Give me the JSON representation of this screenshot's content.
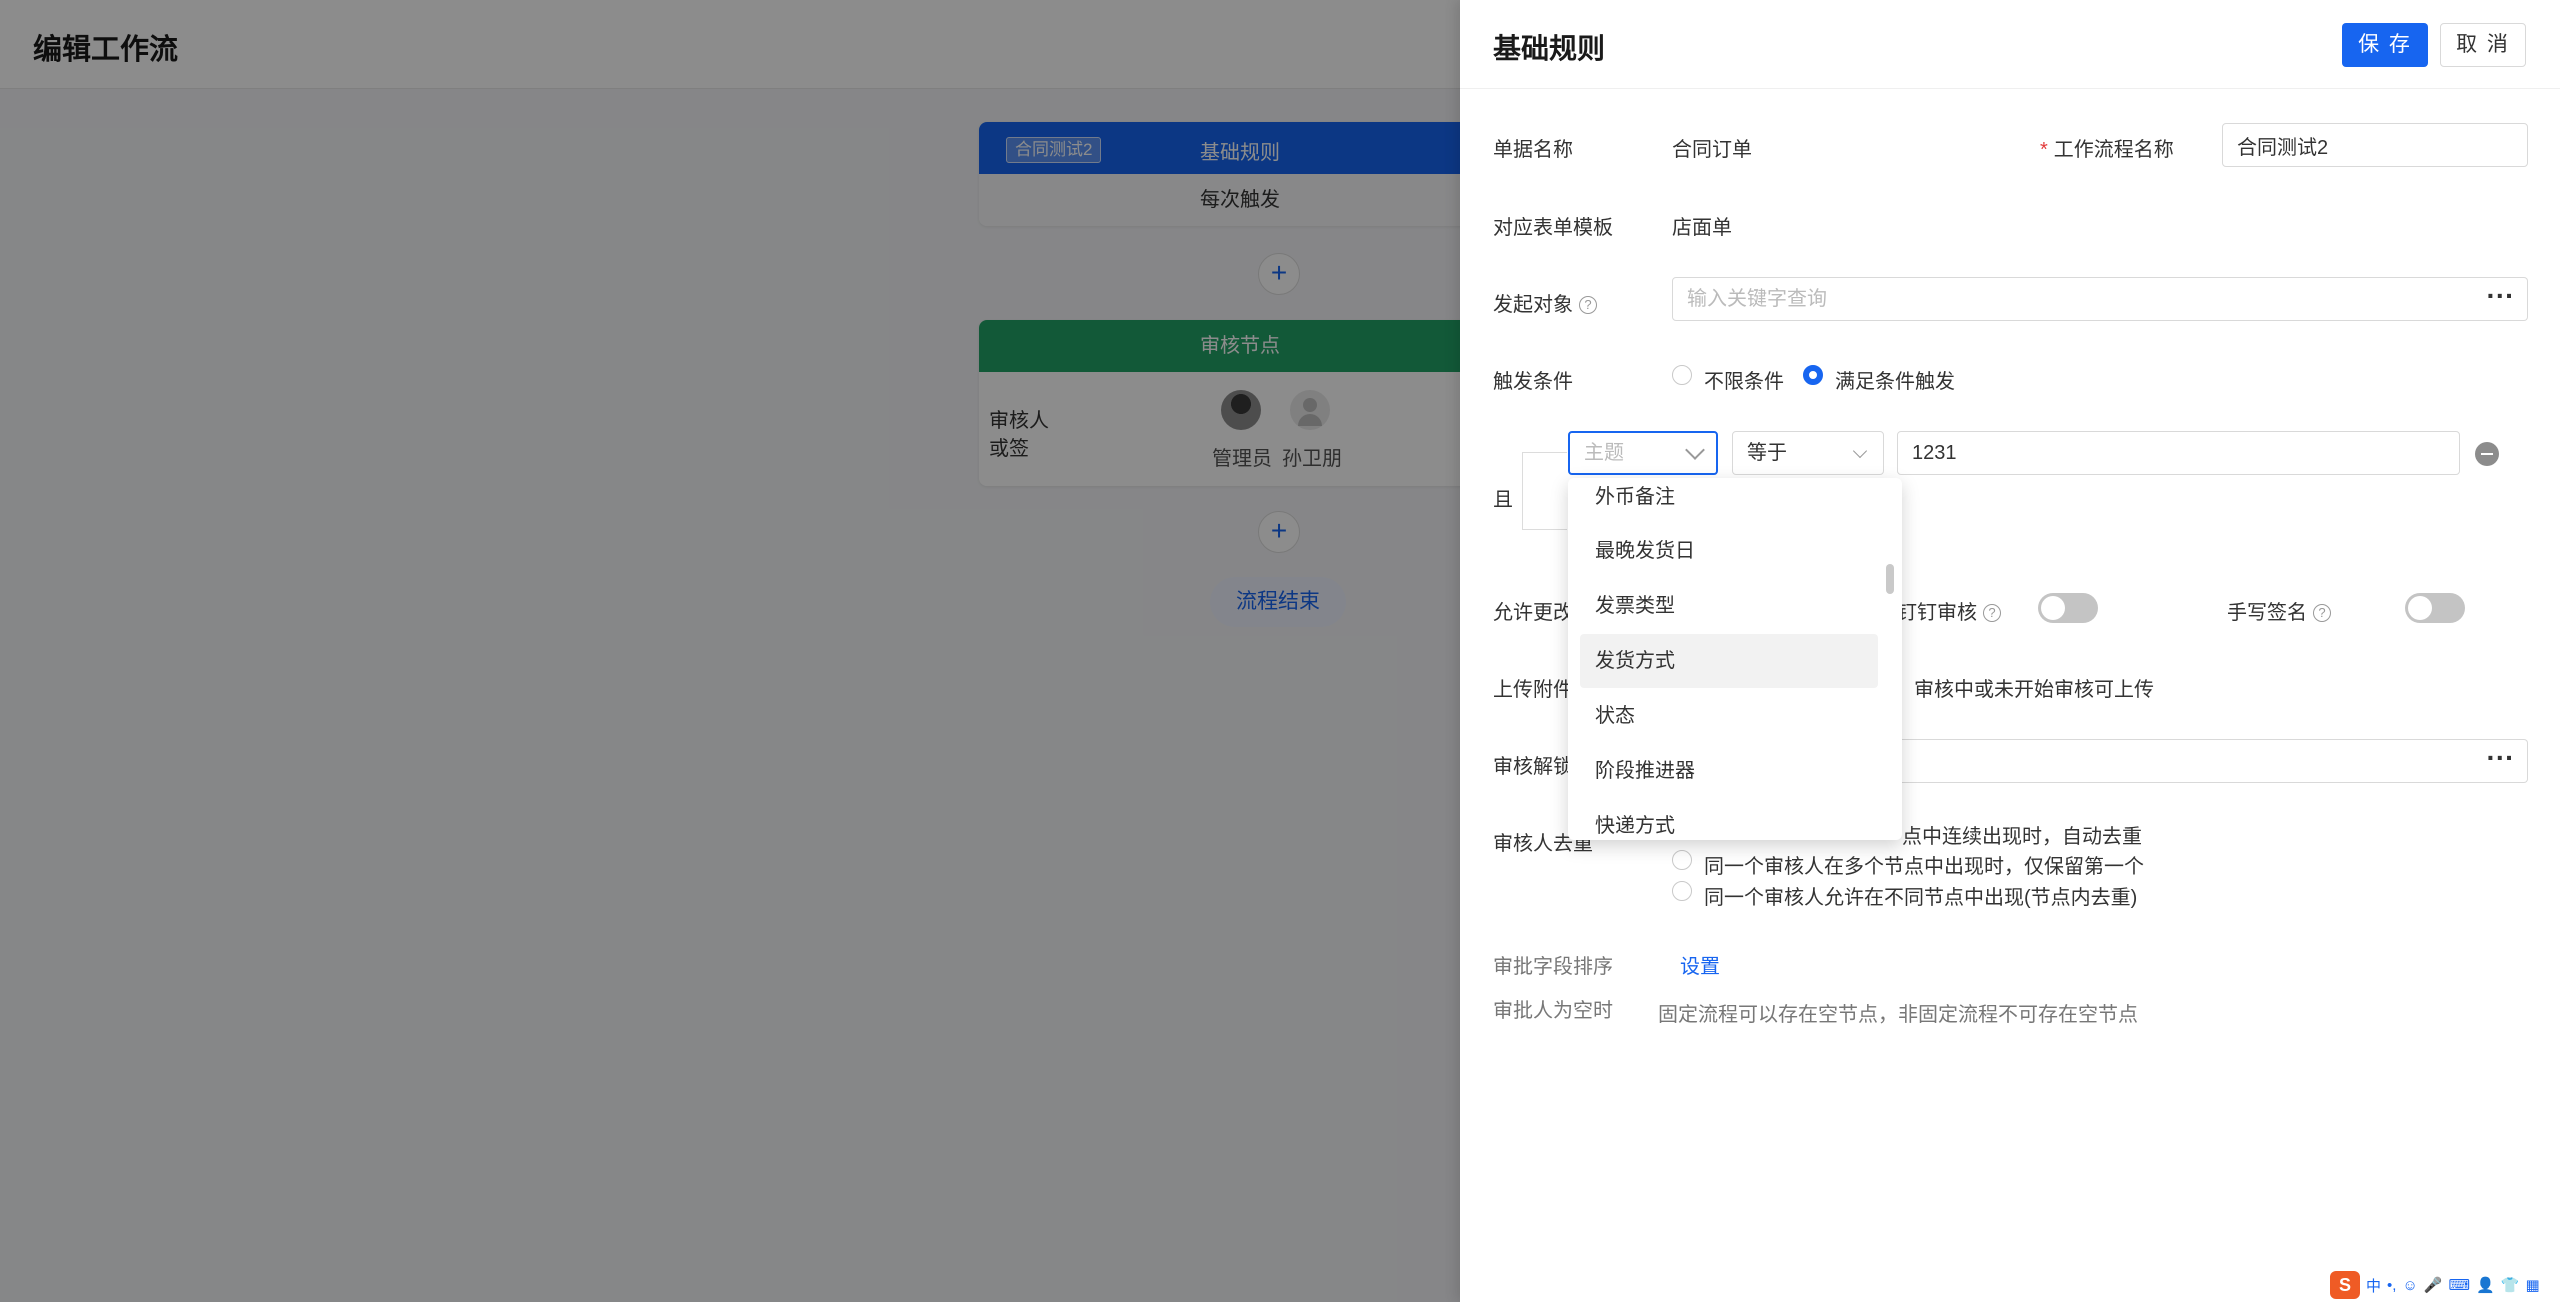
{
  "page": {
    "title": "编辑工作流"
  },
  "flow": {
    "rule_card": {
      "tag": "合同测试2",
      "title": "基础规则",
      "trigger": "每次触发"
    },
    "review_card": {
      "title": "审核节点",
      "label_reviewer": "审核人",
      "label_mode": "或签",
      "reviewers": [
        "管理员",
        "孙卫朋"
      ]
    },
    "plus": "+",
    "end": "流程结束"
  },
  "drawer": {
    "title": "基础规则",
    "save": "保 存",
    "cancel": "取 消",
    "doc_name_label": "单据名称",
    "doc_name_value": "合同订单",
    "workflow_name_label": "工作流程名称",
    "workflow_name_required": "*",
    "workflow_name_value": "合同测试2",
    "form_template_label": "对应表单模板",
    "form_template_value": "店面单",
    "initiator_label": "发起对象",
    "initiator_placeholder": "输入关键字查询",
    "trigger_label": "触发条件",
    "trigger_options": [
      "不限条件",
      "满足条件触发"
    ],
    "trigger_selected": "满足条件触发",
    "condition": {
      "join": "且",
      "field_placeholder": "主题",
      "operator": "等于",
      "value": "1231"
    },
    "allow_change_label": "允许更改",
    "dingtalk_label": "钉钉审核",
    "handwrite_label": "手写签名",
    "upload_label": "上传附件",
    "upload_value": "审核中或未开始审核可上传",
    "unlock_label": "审核解锁",
    "dedupe_label": "审核人去重",
    "dedupe_options": [
      "同一个审核人在多个节点中连续出现时，自动去重",
      "同一个审核人在多个节点中出现时，仅保留第一个",
      "同一个审核人允许在不同节点中出现(节点内去重)"
    ],
    "dedupe_visible_tail": "点中连续出现时，自动去重",
    "field_order_label": "审批字段排序",
    "field_order_link": "设置",
    "empty_approver_label": "审批人为空时",
    "empty_approver_text": "固定流程可以存在空节点，非固定流程不可存在空节点"
  },
  "dropdown": {
    "items": [
      "外币备注",
      "最晚发货日",
      "发票类型",
      "发货方式",
      "状态",
      "阶段推进器",
      "快递方式"
    ],
    "hovered": "发货方式"
  },
  "ime": {
    "logo": "S",
    "items": [
      "中",
      "•,",
      "☺",
      "🎤",
      "⌨",
      "👤",
      "👕",
      "▦"
    ]
  }
}
